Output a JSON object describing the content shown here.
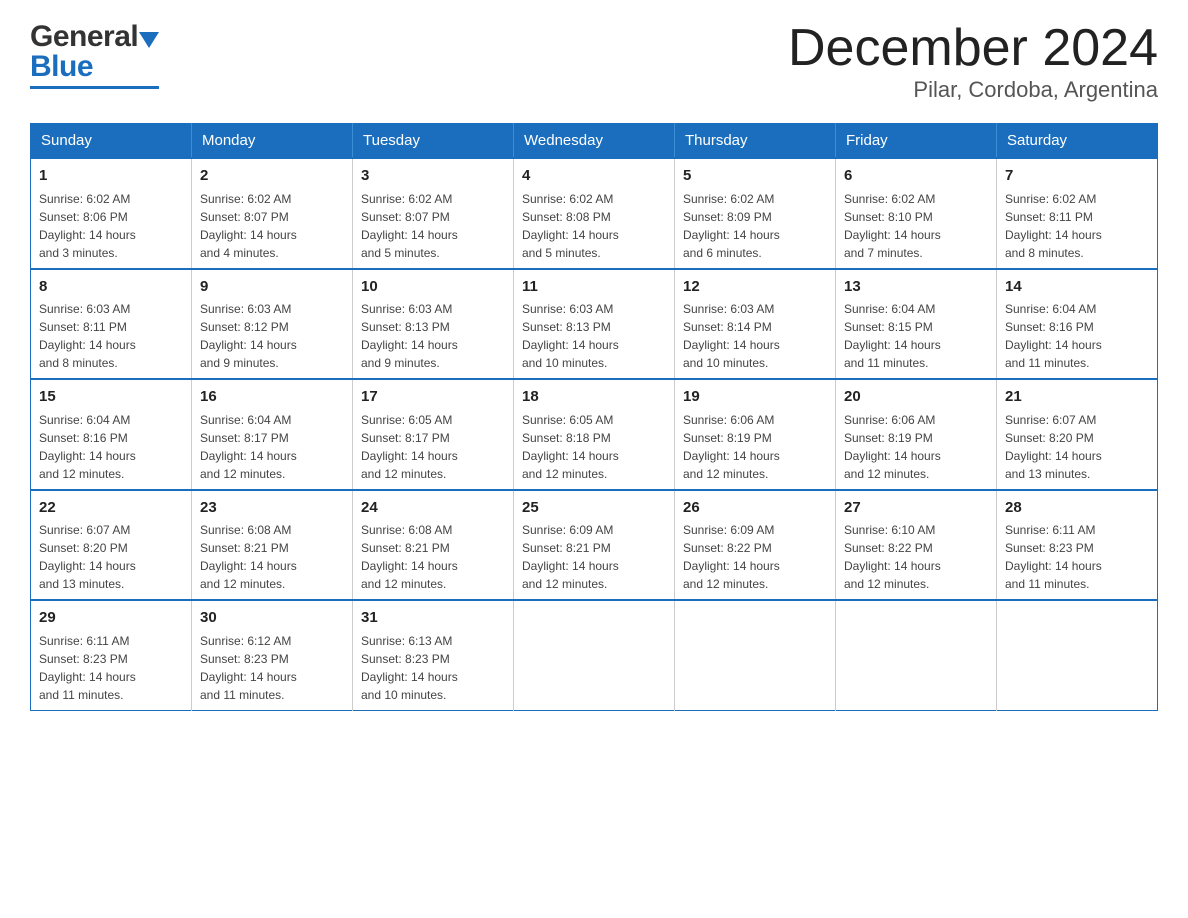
{
  "logo": {
    "text_general": "General",
    "text_blue": "Blue",
    "aria": "GeneralBlue logo"
  },
  "header": {
    "month": "December 2024",
    "location": "Pilar, Cordoba, Argentina"
  },
  "days_of_week": [
    "Sunday",
    "Monday",
    "Tuesday",
    "Wednesday",
    "Thursday",
    "Friday",
    "Saturday"
  ],
  "weeks": [
    [
      {
        "day": "1",
        "sunrise": "6:02 AM",
        "sunset": "8:06 PM",
        "daylight": "14 hours and 3 minutes."
      },
      {
        "day": "2",
        "sunrise": "6:02 AM",
        "sunset": "8:07 PM",
        "daylight": "14 hours and 4 minutes."
      },
      {
        "day": "3",
        "sunrise": "6:02 AM",
        "sunset": "8:07 PM",
        "daylight": "14 hours and 5 minutes."
      },
      {
        "day": "4",
        "sunrise": "6:02 AM",
        "sunset": "8:08 PM",
        "daylight": "14 hours and 5 minutes."
      },
      {
        "day": "5",
        "sunrise": "6:02 AM",
        "sunset": "8:09 PM",
        "daylight": "14 hours and 6 minutes."
      },
      {
        "day": "6",
        "sunrise": "6:02 AM",
        "sunset": "8:10 PM",
        "daylight": "14 hours and 7 minutes."
      },
      {
        "day": "7",
        "sunrise": "6:02 AM",
        "sunset": "8:11 PM",
        "daylight": "14 hours and 8 minutes."
      }
    ],
    [
      {
        "day": "8",
        "sunrise": "6:03 AM",
        "sunset": "8:11 PM",
        "daylight": "14 hours and 8 minutes."
      },
      {
        "day": "9",
        "sunrise": "6:03 AM",
        "sunset": "8:12 PM",
        "daylight": "14 hours and 9 minutes."
      },
      {
        "day": "10",
        "sunrise": "6:03 AM",
        "sunset": "8:13 PM",
        "daylight": "14 hours and 9 minutes."
      },
      {
        "day": "11",
        "sunrise": "6:03 AM",
        "sunset": "8:13 PM",
        "daylight": "14 hours and 10 minutes."
      },
      {
        "day": "12",
        "sunrise": "6:03 AM",
        "sunset": "8:14 PM",
        "daylight": "14 hours and 10 minutes."
      },
      {
        "day": "13",
        "sunrise": "6:04 AM",
        "sunset": "8:15 PM",
        "daylight": "14 hours and 11 minutes."
      },
      {
        "day": "14",
        "sunrise": "6:04 AM",
        "sunset": "8:16 PM",
        "daylight": "14 hours and 11 minutes."
      }
    ],
    [
      {
        "day": "15",
        "sunrise": "6:04 AM",
        "sunset": "8:16 PM",
        "daylight": "14 hours and 12 minutes."
      },
      {
        "day": "16",
        "sunrise": "6:04 AM",
        "sunset": "8:17 PM",
        "daylight": "14 hours and 12 minutes."
      },
      {
        "day": "17",
        "sunrise": "6:05 AM",
        "sunset": "8:17 PM",
        "daylight": "14 hours and 12 minutes."
      },
      {
        "day": "18",
        "sunrise": "6:05 AM",
        "sunset": "8:18 PM",
        "daylight": "14 hours and 12 minutes."
      },
      {
        "day": "19",
        "sunrise": "6:06 AM",
        "sunset": "8:19 PM",
        "daylight": "14 hours and 12 minutes."
      },
      {
        "day": "20",
        "sunrise": "6:06 AM",
        "sunset": "8:19 PM",
        "daylight": "14 hours and 12 minutes."
      },
      {
        "day": "21",
        "sunrise": "6:07 AM",
        "sunset": "8:20 PM",
        "daylight": "14 hours and 13 minutes."
      }
    ],
    [
      {
        "day": "22",
        "sunrise": "6:07 AM",
        "sunset": "8:20 PM",
        "daylight": "14 hours and 13 minutes."
      },
      {
        "day": "23",
        "sunrise": "6:08 AM",
        "sunset": "8:21 PM",
        "daylight": "14 hours and 12 minutes."
      },
      {
        "day": "24",
        "sunrise": "6:08 AM",
        "sunset": "8:21 PM",
        "daylight": "14 hours and 12 minutes."
      },
      {
        "day": "25",
        "sunrise": "6:09 AM",
        "sunset": "8:21 PM",
        "daylight": "14 hours and 12 minutes."
      },
      {
        "day": "26",
        "sunrise": "6:09 AM",
        "sunset": "8:22 PM",
        "daylight": "14 hours and 12 minutes."
      },
      {
        "day": "27",
        "sunrise": "6:10 AM",
        "sunset": "8:22 PM",
        "daylight": "14 hours and 12 minutes."
      },
      {
        "day": "28",
        "sunrise": "6:11 AM",
        "sunset": "8:23 PM",
        "daylight": "14 hours and 11 minutes."
      }
    ],
    [
      {
        "day": "29",
        "sunrise": "6:11 AM",
        "sunset": "8:23 PM",
        "daylight": "14 hours and 11 minutes."
      },
      {
        "day": "30",
        "sunrise": "6:12 AM",
        "sunset": "8:23 PM",
        "daylight": "14 hours and 11 minutes."
      },
      {
        "day": "31",
        "sunrise": "6:13 AM",
        "sunset": "8:23 PM",
        "daylight": "14 hours and 10 minutes."
      },
      {
        "day": "",
        "sunrise": "",
        "sunset": "",
        "daylight": ""
      },
      {
        "day": "",
        "sunrise": "",
        "sunset": "",
        "daylight": ""
      },
      {
        "day": "",
        "sunrise": "",
        "sunset": "",
        "daylight": ""
      },
      {
        "day": "",
        "sunrise": "",
        "sunset": "",
        "daylight": ""
      }
    ]
  ],
  "labels": {
    "sunrise": "Sunrise:",
    "sunset": "Sunset:",
    "daylight": "Daylight:"
  }
}
